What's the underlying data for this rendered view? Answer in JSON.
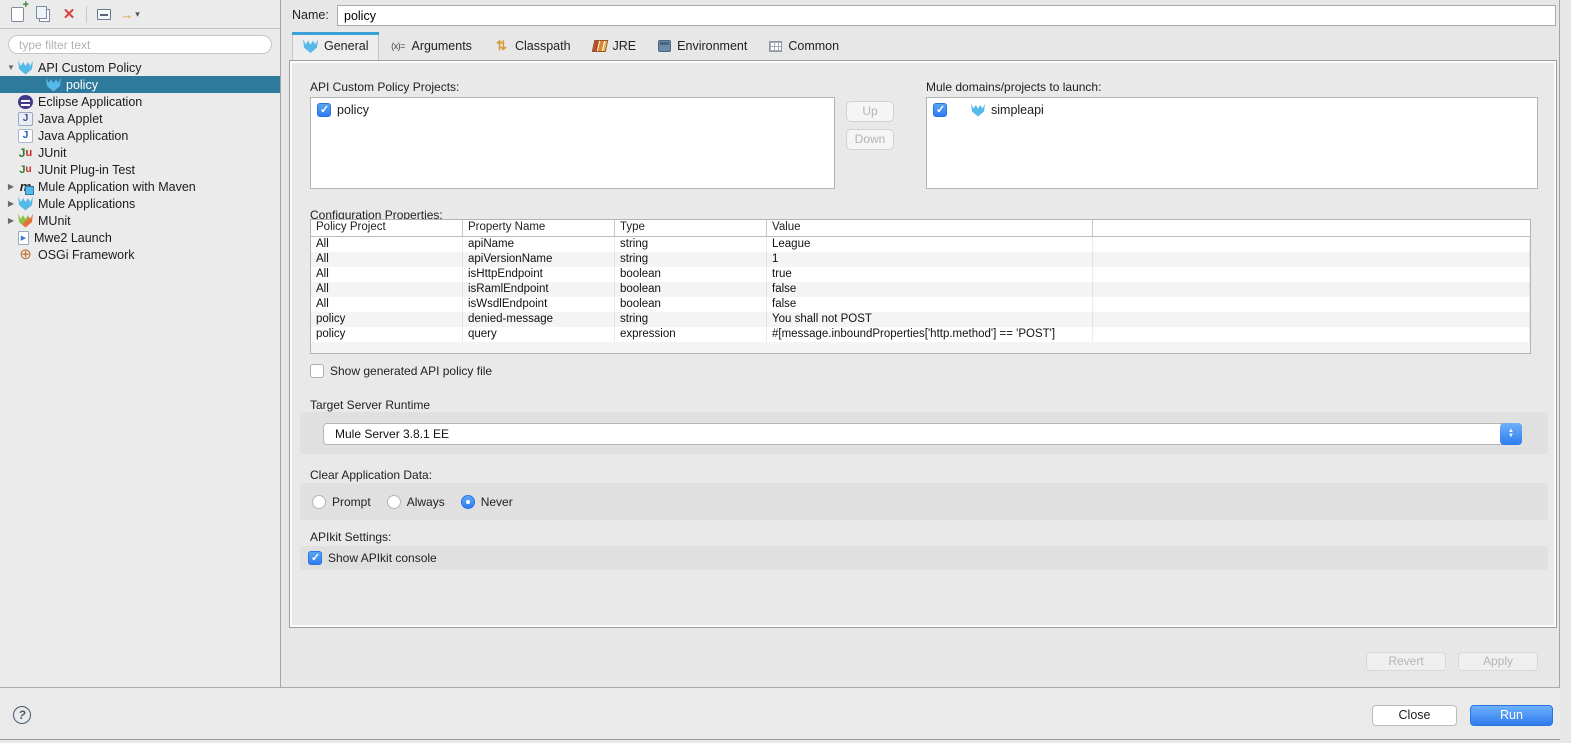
{
  "toolbar": {
    "icons": [
      "new-launch-configuration",
      "duplicate-launch-configuration",
      "delete-launch-configuration",
      "collapse-all",
      "filter-launch-configurations"
    ]
  },
  "sidebar": {
    "filter_placeholder": "type filter text",
    "tree": [
      {
        "label": "API Custom Policy",
        "icon": "mule",
        "arrow": "down",
        "indent": 0,
        "selected": false
      },
      {
        "label": "policy",
        "icon": "mule",
        "arrow": "none",
        "indent": 1,
        "selected": true
      },
      {
        "label": "Eclipse Application",
        "icon": "eclipse",
        "arrow": "none",
        "indent": 0,
        "selected": false
      },
      {
        "label": "Java Applet",
        "icon": "java-applet",
        "arrow": "none",
        "indent": 0,
        "selected": false
      },
      {
        "label": "Java Application",
        "icon": "java-app",
        "arrow": "none",
        "indent": 0,
        "selected": false
      },
      {
        "label": "JUnit",
        "icon": "junit",
        "arrow": "none",
        "indent": 0,
        "selected": false
      },
      {
        "label": "JUnit Plug-in Test",
        "icon": "junit-plugin",
        "arrow": "none",
        "indent": 0,
        "selected": false
      },
      {
        "label": "Mule Application with Maven",
        "icon": "maven-mule",
        "arrow": "right",
        "indent": 0,
        "selected": false
      },
      {
        "label": "Mule Applications",
        "icon": "mule",
        "arrow": "right",
        "indent": 0,
        "selected": false
      },
      {
        "label": "MUnit",
        "icon": "munit",
        "arrow": "right",
        "indent": 0,
        "selected": false
      },
      {
        "label": "Mwe2 Launch",
        "icon": "mwe2",
        "arrow": "none",
        "indent": 0,
        "selected": false
      },
      {
        "label": "OSGi Framework",
        "icon": "osgi",
        "arrow": "none",
        "indent": 0,
        "selected": false
      }
    ]
  },
  "header": {
    "name_label": "Name:",
    "name_value": "policy"
  },
  "tabs": [
    {
      "label": "General",
      "icon": "mule",
      "active": true
    },
    {
      "label": "Arguments",
      "icon": "arguments",
      "active": false
    },
    {
      "label": "Classpath",
      "icon": "classpath",
      "active": false
    },
    {
      "label": "JRE",
      "icon": "jre",
      "active": false
    },
    {
      "label": "Environment",
      "icon": "environment",
      "active": false
    },
    {
      "label": "Common",
      "icon": "common",
      "active": false
    }
  ],
  "general": {
    "policy_projects": {
      "label": "API Custom Policy Projects:",
      "items": [
        {
          "label": "policy",
          "checked": true
        }
      ],
      "up": "Up",
      "down": "Down"
    },
    "mule_domains": {
      "label": "Mule domains/projects to launch:",
      "items": [
        {
          "label": "simpleapi",
          "checked": true,
          "icon": "mule"
        }
      ]
    },
    "config_properties": {
      "label": "Configuration Properties:",
      "columns": [
        "Policy Project",
        "Property Name",
        "Type",
        "Value",
        ""
      ],
      "rows": [
        [
          "All",
          "apiName",
          "string",
          "League"
        ],
        [
          "All",
          "apiVersionName",
          "string",
          "1"
        ],
        [
          "All",
          "isHttpEndpoint",
          "boolean",
          "true"
        ],
        [
          "All",
          "isRamlEndpoint",
          "boolean",
          "false"
        ],
        [
          "All",
          "isWsdlEndpoint",
          "boolean",
          "false"
        ],
        [
          "policy",
          "denied-message",
          "string",
          "You shall not POST"
        ],
        [
          "policy",
          "query",
          "expression",
          "#[message.inboundProperties['http.method'] == 'POST']"
        ]
      ]
    },
    "show_generated_checkbox": {
      "label": "Show generated API policy file",
      "checked": false
    },
    "target_server": {
      "label": "Target Server Runtime",
      "value": "Mule Server 3.8.1 EE"
    },
    "clear_app_data": {
      "label": "Clear Application Data:",
      "options": [
        {
          "label": "Prompt",
          "selected": false
        },
        {
          "label": "Always",
          "selected": false
        },
        {
          "label": "Never",
          "selected": true
        }
      ]
    },
    "apikit": {
      "label": "APIkit Settings:",
      "console_checkbox": {
        "label": "Show APIkit console",
        "checked": true
      }
    }
  },
  "actions": {
    "revert": "Revert",
    "apply": "Apply",
    "close": "Close",
    "run": "Run",
    "help": "?"
  },
  "colors": {
    "selection": "#2e7a9c",
    "accent_blue": "#2f7cf0",
    "mule_blue": "#55b9e9",
    "delete_red": "#d64541"
  }
}
